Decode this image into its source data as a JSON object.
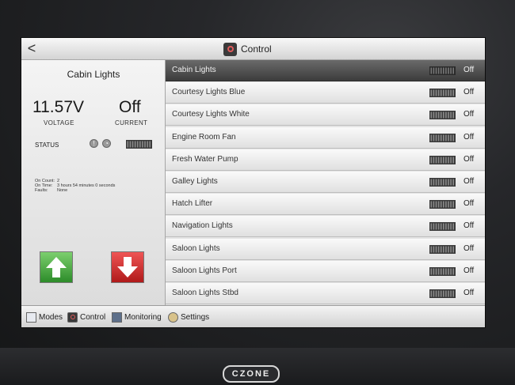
{
  "header": {
    "back_symbol": "<",
    "title": "Control"
  },
  "detail": {
    "title": "Cabin Lights",
    "voltage_value": "11.57V",
    "voltage_label": "VOLTAGE",
    "current_value": "Off",
    "current_label": "CURRENT",
    "status_label": "STATUS",
    "info": [
      {
        "label": "On Count:",
        "value": "2"
      },
      {
        "label": "On Time:",
        "value": "3 hours 54 minutes 0 seconds"
      },
      {
        "label": "Faults:",
        "value": "None"
      }
    ]
  },
  "circuits": [
    {
      "name": "Cabin Lights",
      "state": "Off",
      "selected": true
    },
    {
      "name": "Courtesy Lights Blue",
      "state": "Off"
    },
    {
      "name": "Courtesy Lights White",
      "state": "Off"
    },
    {
      "name": "Engine Room Fan",
      "state": "Off"
    },
    {
      "name": "Fresh Water Pump",
      "state": "Off"
    },
    {
      "name": "Galley Lights",
      "state": "Off"
    },
    {
      "name": "Hatch Lifter",
      "state": "Off"
    },
    {
      "name": "Navigation Lights",
      "state": "Off"
    },
    {
      "name": "Saloon Lights",
      "state": "Off"
    },
    {
      "name": "Saloon Lights Port",
      "state": "Off"
    },
    {
      "name": "Saloon Lights Stbd",
      "state": "Off"
    }
  ],
  "nav": [
    {
      "label": "Modes",
      "icon": "modes-icon"
    },
    {
      "label": "Control",
      "icon": "control-icon"
    },
    {
      "label": "Monitoring",
      "icon": "monitoring-icon"
    },
    {
      "label": "Settings",
      "icon": "settings-icon"
    }
  ],
  "brand": {
    "logo_text": "CZONE"
  },
  "colors": {
    "up": "#3fa63a",
    "down": "#d22a2a",
    "selected_row": "#4a4a4a"
  }
}
